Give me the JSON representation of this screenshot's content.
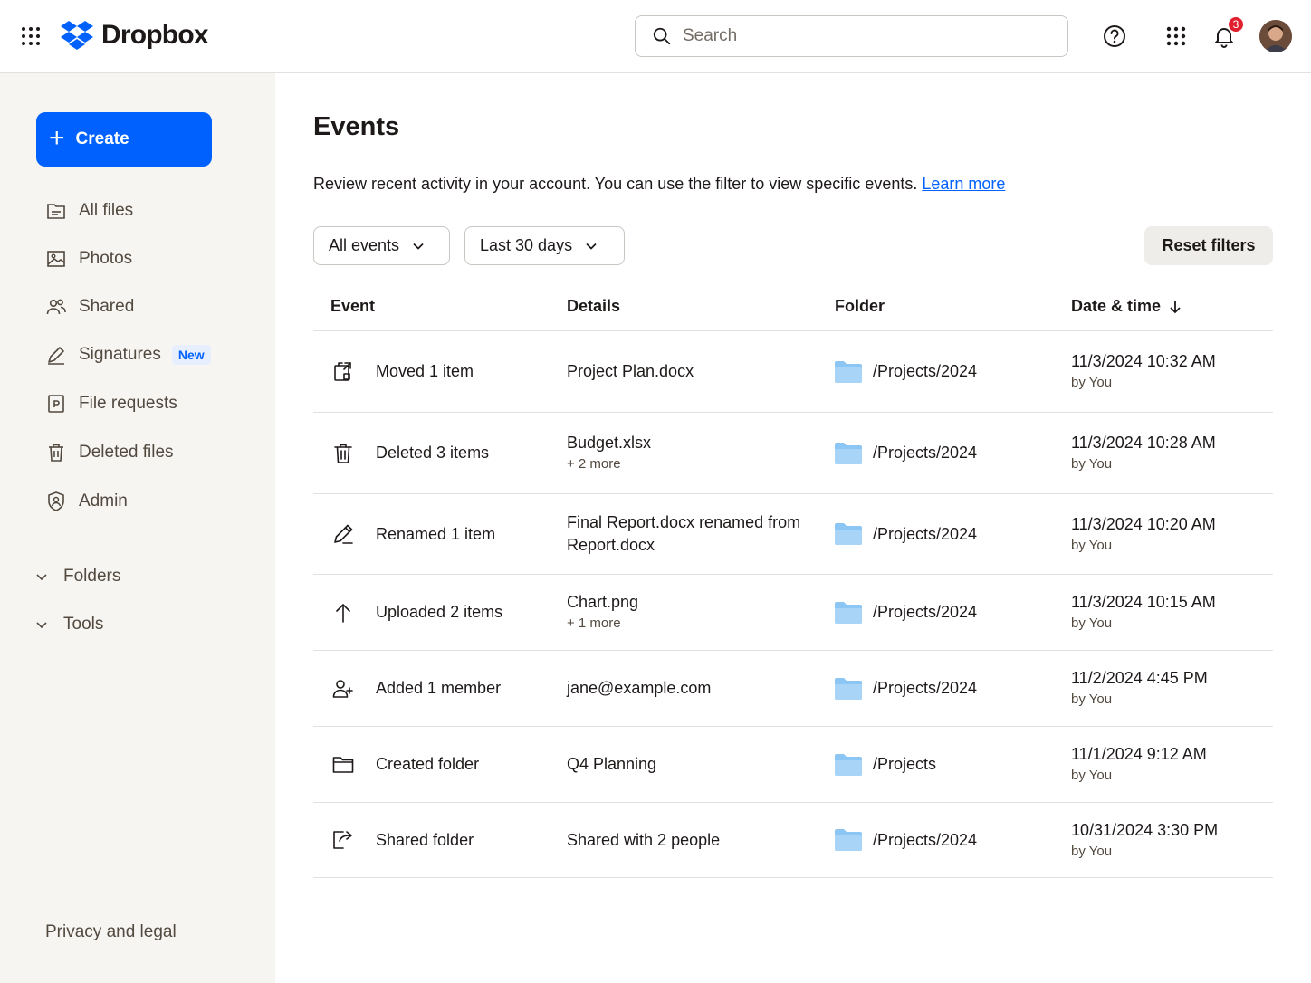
{
  "header": {
    "logo_text": "Dropbox",
    "search_placeholder": "Search",
    "notification_count": "3"
  },
  "sidebar": {
    "create_label": "Create",
    "items": [
      {
        "label": "All files",
        "icon": "folder-icon"
      },
      {
        "label": "Photos",
        "icon": "image-icon"
      },
      {
        "label": "Shared",
        "icon": "people-icon"
      },
      {
        "label": "Signatures",
        "icon": "signature-icon",
        "badge": "New"
      },
      {
        "label": "File requests",
        "icon": "file-request-icon"
      },
      {
        "label": "Deleted files",
        "icon": "trash-icon"
      },
      {
        "label": "Admin",
        "icon": "admin-icon"
      }
    ],
    "sections": [
      {
        "label": "Folders"
      },
      {
        "label": "Tools"
      }
    ],
    "footer": "Privacy and legal"
  },
  "main": {
    "title": "Events",
    "description": "Review recent activity in your account. You can use the filter to view specific events.",
    "learn_more": "Learn more",
    "filters": {
      "event_type": "All events",
      "date_range": "Last 30 days",
      "reset_label": "Reset filters"
    },
    "table": {
      "columns": [
        "Event",
        "Details",
        "Folder",
        "Date & time"
      ],
      "rows": [
        {
          "icon": "move-icon",
          "event": "Moved 1 item",
          "details": "Project Plan.docx",
          "details_sub": "",
          "folder": "/Projects/2024",
          "date": "11/3/2024 10:32 AM",
          "by": "by You"
        },
        {
          "icon": "trash-icon",
          "event": "Deleted 3 items",
          "details": "Budget.xlsx",
          "details_sub": "+ 2 more",
          "folder": "/Projects/2024",
          "date": "11/3/2024 10:28 AM",
          "by": "by You"
        },
        {
          "icon": "pencil-icon",
          "event": "Renamed 1 item",
          "details": "Final Report.docx renamed from Report.docx",
          "details_sub": "",
          "folder": "/Projects/2024",
          "date": "11/3/2024 10:20 AM",
          "by": "by You"
        },
        {
          "icon": "upload-icon",
          "event": "Uploaded 2 items",
          "details": "Chart.png",
          "details_sub": "+ 1 more",
          "folder": "/Projects/2024",
          "date": "11/3/2024 10:15 AM",
          "by": "by You"
        },
        {
          "icon": "add-member-icon",
          "event": "Added 1 member",
          "details": "jane@example.com",
          "details_sub": "",
          "folder": "/Projects/2024",
          "date": "11/2/2024 4:45 PM",
          "by": "by You"
        },
        {
          "icon": "folder-outline-icon",
          "event": "Created folder",
          "details": "Q4 Planning",
          "details_sub": "",
          "folder": "/Projects",
          "date": "11/1/2024 9:12 AM",
          "by": "by You"
        },
        {
          "icon": "share-icon",
          "event": "Shared folder",
          "details": "Shared with 2 people",
          "details_sub": "",
          "folder": "/Projects/2024",
          "date": "10/31/2024 3:30 PM",
          "by": "by You"
        }
      ]
    }
  },
  "colors": {
    "accent": "#0061fe",
    "sidebar_bg": "#f7f5f2",
    "folder_blue": "#8cc6f5",
    "badge_red": "#e0202f"
  }
}
